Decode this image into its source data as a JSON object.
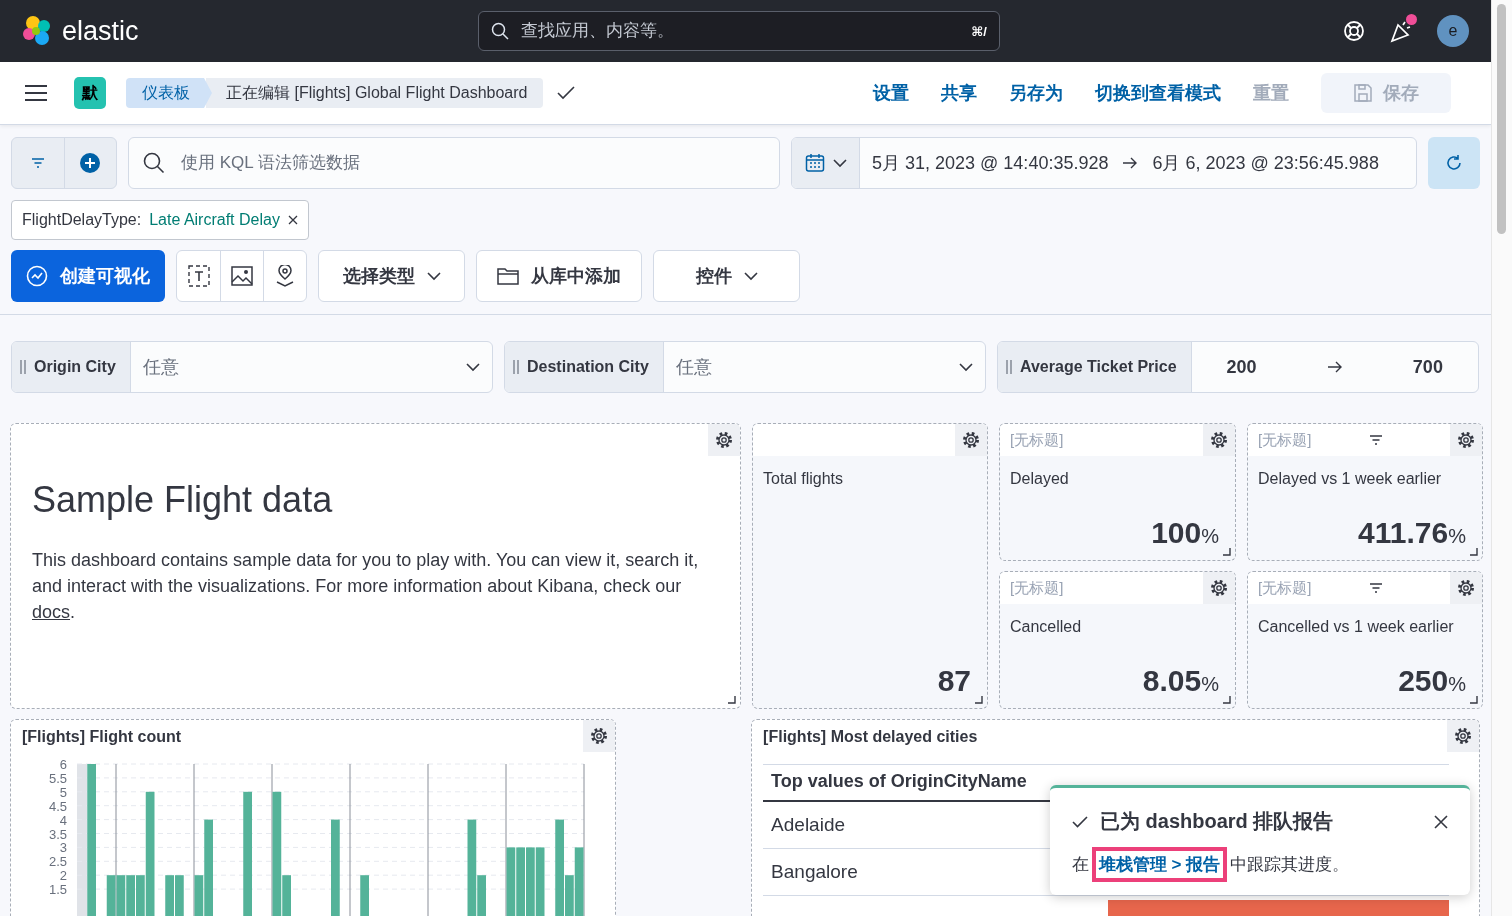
{
  "header": {
    "logo": "elastic",
    "search": {
      "placeholder": "查找应用、内容等。",
      "shortcut": "⌘/"
    },
    "avatar": "e"
  },
  "app_bar": {
    "space_badge": "默",
    "breadcrumbs": [
      "仪表板",
      "正在编辑 [Flights] Global Flight Dashboard"
    ],
    "actions": [
      {
        "label": "设置",
        "disabled": false
      },
      {
        "label": "共享",
        "disabled": false
      },
      {
        "label": "另存为",
        "disabled": false
      },
      {
        "label": "切换到查看模式",
        "disabled": false
      },
      {
        "label": "重置",
        "disabled": true
      }
    ],
    "save_button": {
      "label": "保存",
      "disabled": true
    }
  },
  "query_bar": {
    "placeholder": "使用 KQL 语法筛选数据",
    "start": "5月 31, 2023 @ 14:40:35.928",
    "end": "6月 6, 2023 @ 23:56:45.988"
  },
  "filters": [
    {
      "field": "FlightDelayType:",
      "value": "Late Aircraft Delay"
    }
  ],
  "toolbar": {
    "create": "创建可视化",
    "buttons": [
      {
        "label": "选择类型",
        "kind": "dropdown"
      },
      {
        "label": "从库中添加",
        "kind": "library"
      },
      {
        "label": "控件",
        "kind": "dropdown"
      }
    ]
  },
  "controls": [
    {
      "kind": "options",
      "label": "Origin City",
      "value": "任意"
    },
    {
      "kind": "options",
      "label": "Destination City",
      "value": "任意"
    },
    {
      "kind": "range",
      "label": "Average Ticket Price",
      "min": "200",
      "max": "700"
    }
  ],
  "markdown_panel": {
    "heading": "Sample Flight data",
    "body": "This dashboard contains sample data for you to play with. You can view it, search it, and interact with the visualizations. For more information about Kibana, check our",
    "link": "docs",
    "after": "."
  },
  "metrics": [
    {
      "label": "Total flights",
      "value": "87",
      "has_filter": false
    },
    {
      "title": "[无标题]",
      "label": "Delayed",
      "value": "100",
      "unit": "%",
      "has_filter": false
    },
    {
      "title": "[无标题]",
      "label": "Delayed vs 1 week earlier",
      "value": "411.76",
      "unit": "%",
      "has_filter": true
    },
    {
      "title": "[无标题]",
      "label": "Cancelled",
      "value": "8.05",
      "unit": "%",
      "has_filter": false
    },
    {
      "title": "[无标题]",
      "label": "Cancelled vs 1 week earlier",
      "value": "250",
      "unit": "%",
      "has_filter": true
    }
  ],
  "flight_count": {
    "title": "[Flights] Flight count",
    "chart_data": {
      "type": "bar",
      "ylim": [
        0,
        6
      ],
      "grid": true,
      "yticks": [
        1.5,
        2,
        2.5,
        3,
        3.5,
        4,
        4.5,
        5,
        5.5,
        6
      ],
      "values": [
        null,
        6,
        null,
        2,
        2,
        2,
        2,
        5,
        null,
        2,
        2,
        null,
        2,
        4,
        null,
        null,
        null,
        5,
        null,
        null,
        5,
        2,
        null,
        null,
        null,
        null,
        4,
        null,
        null,
        2,
        null,
        null,
        null,
        null,
        null,
        null,
        null,
        null,
        null,
        null,
        4,
        2,
        null,
        null,
        3,
        3,
        3,
        3,
        null,
        4,
        2,
        3
      ]
    }
  },
  "delayed_cities": {
    "title": "[Flights] Most delayed cities",
    "column": "Top values of OriginCityName",
    "rows": [
      "Adelaide",
      "Bangalore"
    ]
  },
  "toast": {
    "title": "已为 dashboard 排队报告",
    "before": "在",
    "link": "堆栈管理 > 报告",
    "after": "中跟踪其进度。"
  }
}
